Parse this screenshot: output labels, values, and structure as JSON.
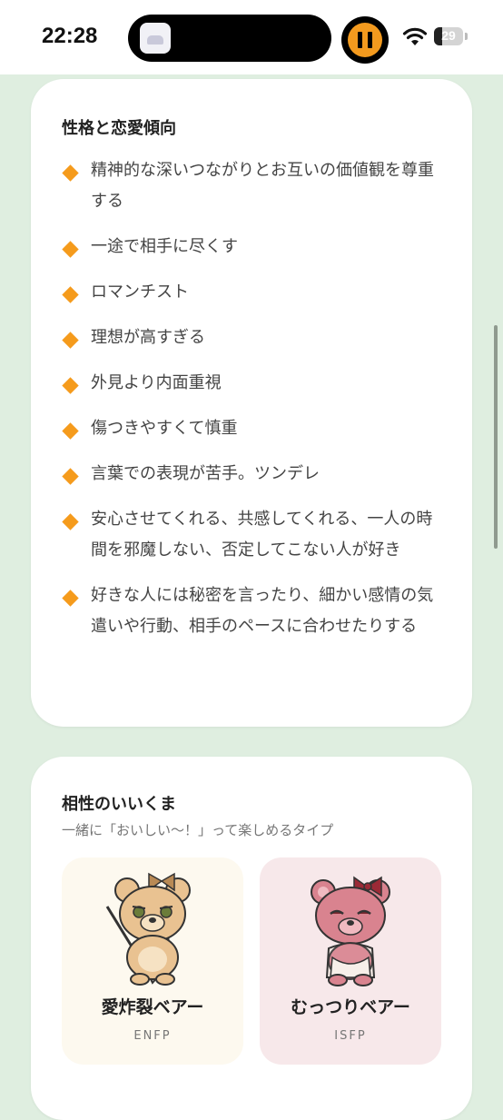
{
  "status_bar": {
    "time": "22:28",
    "battery": "29",
    "timer_color": "#f39a1e"
  },
  "personality": {
    "title": "性格と恋愛傾向",
    "bullet_color": "#f59b1c",
    "items": [
      "精神的な深いつながりとお互いの価値観を尊重する",
      "一途で相手に尽くす",
      "ロマンチスト",
      "理想が高すぎる",
      "外見より内面重視",
      "傷つきやすくて慎重",
      "言葉での表現が苦手。ツンデレ",
      "安心させてくれる、共感してくれる、一人の時間を邪魔しない、否定してこない人が好き",
      "好きな人には秘密を言ったり、細かい感情の気遣いや行動、相手のペースに合わせたりする"
    ]
  },
  "compatibility": {
    "title": "相性のいいくま",
    "subtitle": "一緒に「おいしい〜！」って楽しめるタイプ",
    "bears": [
      {
        "name": "愛炸裂ベアー",
        "type": "ENFP",
        "icon": "beige-bear-scythe-icon"
      },
      {
        "name": "むっつりベアー",
        "type": "ISFP",
        "icon": "pink-bear-bow-icon"
      }
    ]
  }
}
